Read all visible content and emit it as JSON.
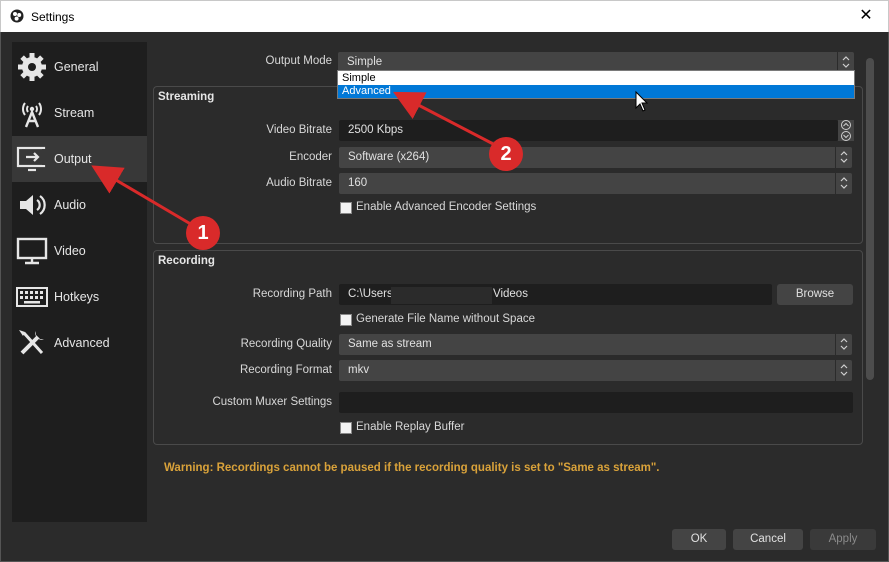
{
  "window": {
    "title": "Settings",
    "close_glyph": "✕"
  },
  "sidebar": {
    "items": [
      {
        "label": "General",
        "icon": "gear-icon",
        "selected": false
      },
      {
        "label": "Stream",
        "icon": "broadcast-icon",
        "selected": false
      },
      {
        "label": "Output",
        "icon": "output-icon",
        "selected": true
      },
      {
        "label": "Audio",
        "icon": "speaker-icon",
        "selected": false
      },
      {
        "label": "Video",
        "icon": "monitor-icon",
        "selected": false
      },
      {
        "label": "Hotkeys",
        "icon": "keyboard-icon",
        "selected": false
      },
      {
        "label": "Advanced",
        "icon": "tools-icon",
        "selected": false
      }
    ]
  },
  "output_mode": {
    "label": "Output Mode",
    "value": "Simple",
    "options": [
      "Simple",
      "Advanced"
    ],
    "highlighted": "Advanced"
  },
  "streaming": {
    "title": "Streaming",
    "video_bitrate": {
      "label": "Video Bitrate",
      "value": "2500 Kbps"
    },
    "encoder": {
      "label": "Encoder",
      "value": "Software (x264)"
    },
    "audio_bitrate": {
      "label": "Audio Bitrate",
      "value": "160"
    },
    "advanced_encoder": {
      "label": "Enable Advanced Encoder Settings",
      "checked": false
    }
  },
  "recording": {
    "title": "Recording",
    "path": {
      "label": "Recording Path",
      "value_prefix": "C:\\Users",
      "value_suffix": "Videos",
      "browse": "Browse"
    },
    "no_space": {
      "label": "Generate File Name without Space",
      "checked": false
    },
    "quality": {
      "label": "Recording Quality",
      "value": "Same as stream"
    },
    "format": {
      "label": "Recording Format",
      "value": "mkv"
    },
    "muxer": {
      "label": "Custom Muxer Settings",
      "value": ""
    },
    "replay_buffer": {
      "label": "Enable Replay Buffer",
      "checked": false
    }
  },
  "warning": "Warning: Recordings cannot be paused if the recording quality is set to \"Same as stream\".",
  "footer": {
    "ok": "OK",
    "cancel": "Cancel",
    "apply": "Apply"
  },
  "annotations": {
    "badge1": "1",
    "badge2": "2"
  },
  "colors": {
    "accent": "#0078d7",
    "warning": "#d9a23a",
    "annotation": "#d92a2a"
  }
}
